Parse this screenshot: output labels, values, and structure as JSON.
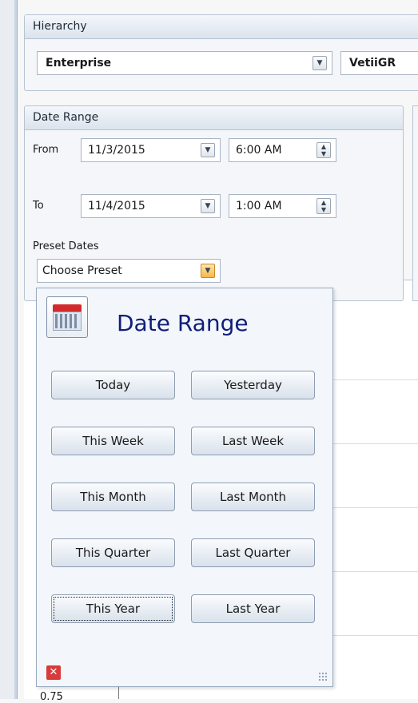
{
  "hierarchy": {
    "title": "Hierarchy",
    "level1": "Enterprise",
    "level2": "VetiiGR"
  },
  "date_range_panel": {
    "title": "Date Range",
    "from_label": "From",
    "to_label": "To",
    "from_date": "11/3/2015",
    "from_time": "6:00 AM",
    "to_date": "11/4/2015",
    "to_time": "1:00 AM",
    "preset_label": "Preset Dates",
    "preset_value": "Choose Preset"
  },
  "popup": {
    "title": "Date Range",
    "buttons": [
      "Today",
      "Yesterday",
      "This Week",
      "Last Week",
      "This Month",
      "Last Month",
      "This Quarter",
      "Last Quarter",
      "This Year",
      "Last Year"
    ]
  },
  "chart": {
    "ytick_visible": "0.75"
  },
  "colors": {
    "accent": "#0f1e7a",
    "close": "#d93a3a",
    "calendar_red": "#d22a2a"
  }
}
